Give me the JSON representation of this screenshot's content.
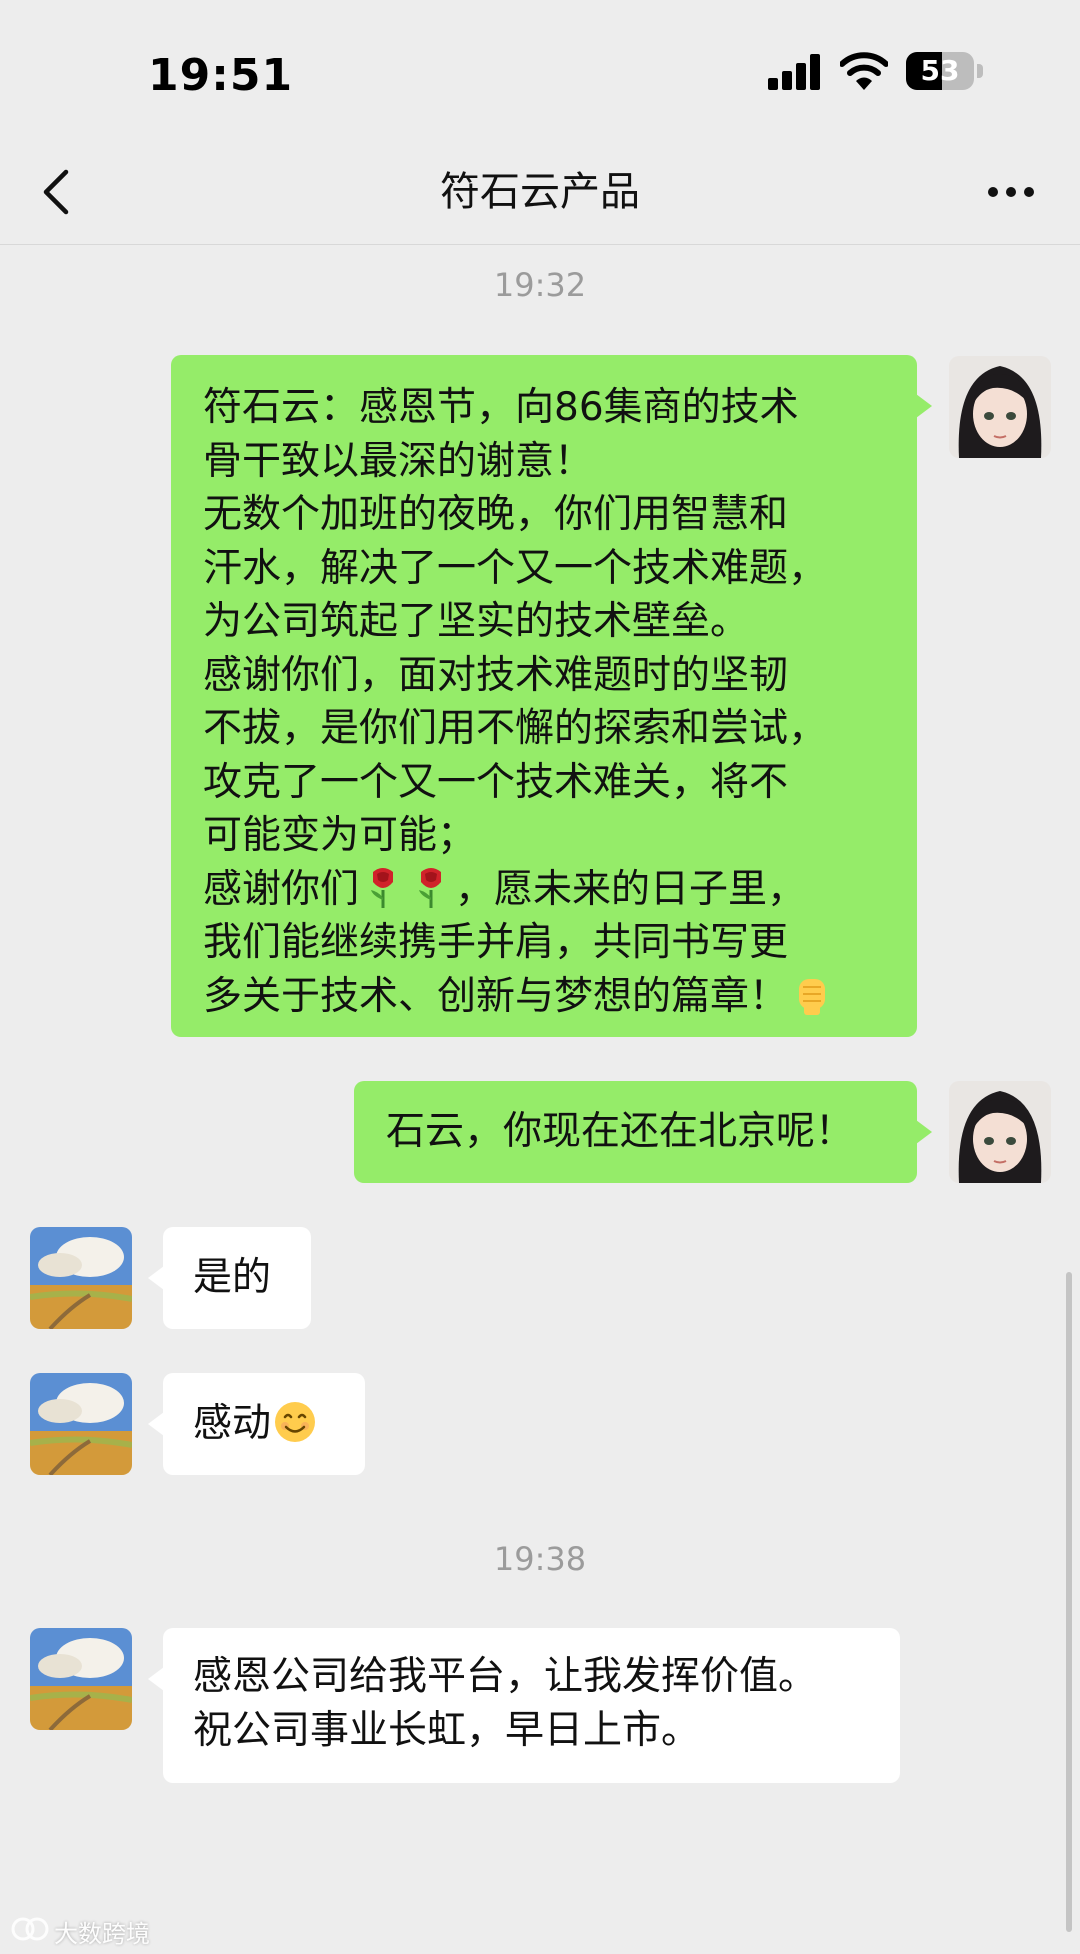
{
  "status": {
    "time": "19:51",
    "battery": "53",
    "battery_level": 0.53
  },
  "header": {
    "title": "符石云产品",
    "back_icon": "chevron-left-icon",
    "more_icon": "more-dots-icon"
  },
  "messages": {
    "ts1": "19:32",
    "m1": {
      "line1": "符石云：感恩节，向86集商的技术",
      "line2": "骨干致以最深的谢意！",
      "line3": "无数个加班的夜晚，你们用智慧和",
      "line4": "汗水，解决了一个又一个技术难题，",
      "line5": "为公司筑起了坚实的技术壁垒。",
      "line6": "感谢你们，面对技术难题时的坚韧",
      "line7": "不拔，是你们用不懈的探索和尝试，",
      "line8": "攻克了一个又一个技术难关，将不",
      "line9": "可能变为可能；",
      "line10_pre": "感谢你们",
      "line10_post": "，愿未来的日子里，",
      "line11": "我们能继续携手并肩，共同书写更",
      "line12": "多关于技术、创新与梦想的篇章！"
    },
    "m2": "石云，你现在还在北京呢！",
    "m3": "是的",
    "m4": "感动",
    "ts2": "19:38",
    "m5": {
      "line1": "感恩公司给我平台，让我发挥价值。",
      "line2": "祝公司事业长虹，早日上市。"
    }
  },
  "watermark": "大数跨境",
  "colors": {
    "out_bubble": "#95ec69",
    "in_bubble": "#ffffff",
    "background": "#ededed"
  }
}
